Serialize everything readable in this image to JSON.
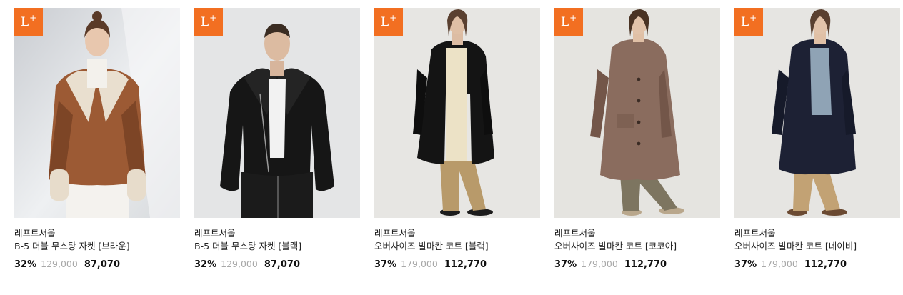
{
  "badge": {
    "letter": "L",
    "plus": "+"
  },
  "colors": {
    "badge_bg": "#f26f21",
    "original_price": "#a8a8a8"
  },
  "products": [
    {
      "brand": "레프트서울",
      "name": "B-5 더블 무스탕 자켓 [브라운]",
      "discount": "32%",
      "original_price": "129,000",
      "sale_price": "87,070",
      "image": "model-brown-shearling-jacket"
    },
    {
      "brand": "레프트서울",
      "name": "B-5 더블 무스탕 자켓 [블랙]",
      "discount": "32%",
      "original_price": "129,000",
      "sale_price": "87,070",
      "image": "model-black-shearling-jacket"
    },
    {
      "brand": "레프트서울",
      "name": "오버사이즈 발마칸 코트 [블랙]",
      "discount": "37%",
      "original_price": "179,000",
      "sale_price": "112,770",
      "image": "model-black-long-coat"
    },
    {
      "brand": "레프트서울",
      "name": "오버사이즈 발마칸 코트 [코코아]",
      "discount": "37%",
      "original_price": "179,000",
      "sale_price": "112,770",
      "image": "model-cocoa-long-coat"
    },
    {
      "brand": "레프트서울",
      "name": "오버사이즈 발마칸 코트 [네이비]",
      "discount": "37%",
      "original_price": "179,000",
      "sale_price": "112,770",
      "image": "model-navy-long-coat"
    }
  ]
}
